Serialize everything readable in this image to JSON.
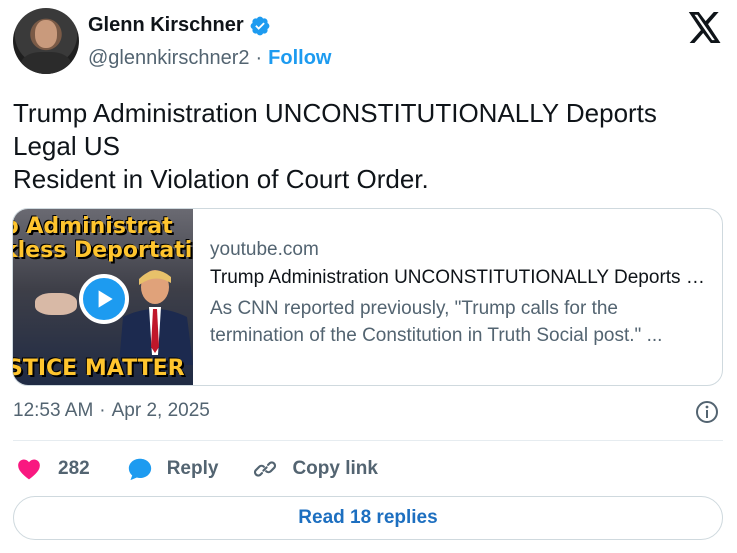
{
  "author": {
    "display_name": "Glenn Kirschner",
    "handle": "@glennkirschner2",
    "separator": "·",
    "follow_label": "Follow",
    "verified": true
  },
  "tweet": {
    "text_lines": [
      "Trump Administration UNCONSTITUTIONALLY Deports",
      "Legal US",
      "Resident in Violation of Court Order."
    ]
  },
  "card": {
    "thumbnail_text_lines": [
      "p Administrat",
      "kless Deportati"
    ],
    "thumbnail_bottom_text": "STICE MATTER",
    "domain": "youtube.com",
    "title": "Trump Administration UNCONSTITUTIONALLY Deports Legal US Resident in Violation of Court Order.",
    "description_lines": [
      "As CNN reported previously, \"Trump calls for the",
      "termination of the Constitution in Truth Social post.\" ..."
    ]
  },
  "meta": {
    "time": "12:53 AM",
    "separator": "·",
    "date": "Apr 2, 2025"
  },
  "actions": {
    "like_count": "282",
    "reply_label": "Reply",
    "copy_link_label": "Copy link"
  },
  "read_replies_label": "Read 18 replies",
  "colors": {
    "accent": "#1d9bf0",
    "like": "#f91880",
    "text": "#0f1419",
    "muted": "#536471",
    "border": "#cfd9de"
  },
  "icons": [
    "verified-badge-icon",
    "x-logo-icon",
    "play-icon",
    "info-icon",
    "heart-icon",
    "reply-bubble-icon",
    "link-icon"
  ]
}
